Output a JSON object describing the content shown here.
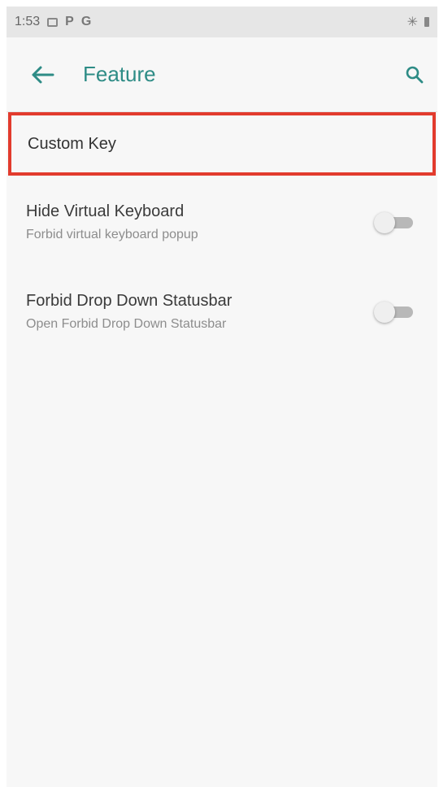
{
  "status_bar": {
    "time": "1:53",
    "icons": [
      "image-icon",
      "p-icon",
      "google-icon"
    ],
    "right_icons": [
      "bluetooth-icon",
      "battery-icon"
    ]
  },
  "app_bar": {
    "title": "Feature",
    "back_icon": "arrow-left-icon",
    "search_icon": "search-icon",
    "accent_color": "#2e8c86"
  },
  "items": [
    {
      "title": "Custom Key",
      "highlighted": true,
      "highlight_color": "#e23b2d"
    },
    {
      "title": "Hide Virtual Keyboard",
      "summary": "Forbid virtual keyboard popup",
      "switch_on": false
    },
    {
      "title": "Forbid Drop Down Statusbar",
      "summary": "Open Forbid Drop Down Statusbar",
      "switch_on": false
    }
  ]
}
